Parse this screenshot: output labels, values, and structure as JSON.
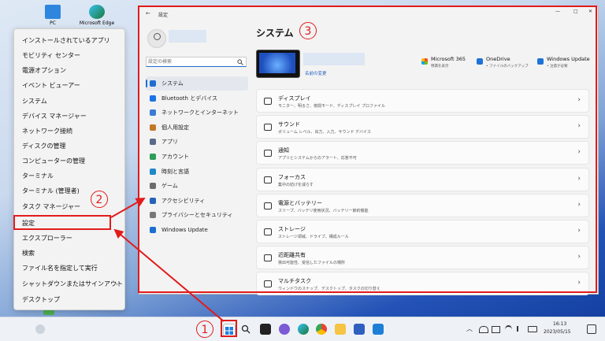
{
  "desktop": {
    "icons": [
      {
        "label": "PC"
      },
      {
        "label": "Microsoft Edge"
      }
    ]
  },
  "winx_menu": {
    "items": [
      {
        "label": "インストールされているアプリ"
      },
      {
        "label": "モビリティ センター"
      },
      {
        "label": "電源オプション"
      },
      {
        "label": "イベント ビューアー"
      },
      {
        "label": "システム"
      },
      {
        "label": "デバイス マネージャー"
      },
      {
        "label": "ネットワーク接続"
      },
      {
        "label": "ディスクの管理"
      },
      {
        "label": "コンピューターの管理"
      },
      {
        "label": "ターミナル"
      },
      {
        "label": "ターミナル (管理者)"
      },
      {
        "label": "タスク マネージャー"
      },
      {
        "label": "設定"
      },
      {
        "label": "エクスプローラー"
      },
      {
        "label": "検索"
      },
      {
        "label": "ファイル名を指定して実行"
      },
      {
        "label": "シャットダウンまたはサインアウト",
        "arrow": "›"
      },
      {
        "label": "デスクトップ"
      }
    ]
  },
  "settings": {
    "window_title": "設定",
    "back_glyph": "←",
    "window_controls": {
      "minimize": "—",
      "maximize": "□",
      "close": "✕"
    },
    "search_placeholder": "設定の検索",
    "nav": [
      {
        "label": "システム",
        "color": "#1f6fd1"
      },
      {
        "label": "Bluetooth とデバイス",
        "color": "#1a73e8"
      },
      {
        "label": "ネットワークとインターネット",
        "color": "#3a7bd5"
      },
      {
        "label": "個人用設定",
        "color": "#c0772a"
      },
      {
        "label": "アプリ",
        "color": "#5a6a8a"
      },
      {
        "label": "アカウント",
        "color": "#2e9d5b"
      },
      {
        "label": "時刻と言語",
        "color": "#1e88c8"
      },
      {
        "label": "ゲーム",
        "color": "#6b6b6b"
      },
      {
        "label": "アクセシビリティ",
        "color": "#2563b8"
      },
      {
        "label": "プライバシーとセキュリティ",
        "color": "#777777"
      },
      {
        "label": "Windows Update",
        "color": "#1a6fd0"
      }
    ],
    "page_title": "システム",
    "device_rename": "名前の変更",
    "quick": [
      {
        "title": "Microsoft 365",
        "sub": "特典を表示"
      },
      {
        "title": "OneDrive",
        "sub": "• ファイルのバックアップ"
      },
      {
        "title": "Windows Update",
        "sub": "• 注意が必要"
      }
    ],
    "cards": [
      {
        "title": "ディスプレイ",
        "sub": "モニター、明るさ、夜間モード、ディスプレイ プロファイル"
      },
      {
        "title": "サウンド",
        "sub": "ボリューム レベル、出力、入力、サウンド デバイス"
      },
      {
        "title": "通知",
        "sub": "アプリとシステムからのアラート、応答不可"
      },
      {
        "title": "フォーカス",
        "sub": "集中の妨げを減らす"
      },
      {
        "title": "電源とバッテリー",
        "sub": "スリープ、バッテリ使用状況、バッテリー節約機能"
      },
      {
        "title": "ストレージ",
        "sub": "ストレージ領域、ドライブ、構成ルール"
      },
      {
        "title": "近距離共有",
        "sub": "検出可能性、受信したファイルの場所"
      },
      {
        "title": "マルチタスク",
        "sub": "ウィンドウのスナップ、デスクトップ、タスクの切り替え"
      }
    ],
    "chevron": "›"
  },
  "taskbar": {
    "tray_up": "︿",
    "time": "16:13",
    "date": "2023/05/15"
  },
  "annotations": {
    "badge1": "1",
    "badge2": "2",
    "badge3": "3",
    "accent": "#e21b1b"
  }
}
